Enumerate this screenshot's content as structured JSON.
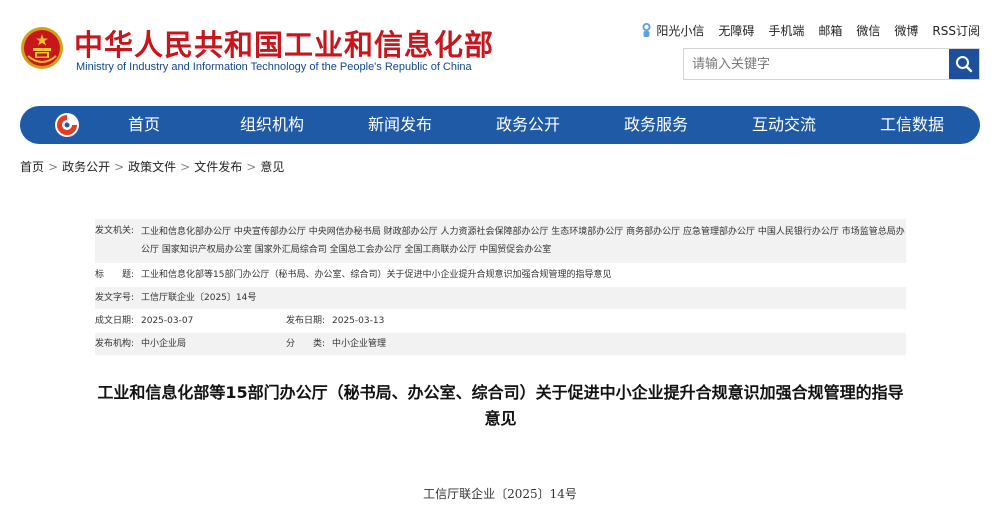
{
  "header": {
    "title_zh": "中华人民共和国工业和信息化部",
    "title_en": "Ministry of Industry and Information Technology of the People's Republic of China",
    "links": [
      "阳光小信",
      "无障碍",
      "手机端",
      "邮箱",
      "微信",
      "微博",
      "RSS订阅"
    ],
    "search_placeholder": "请输入关键字"
  },
  "nav": {
    "items": [
      "首页",
      "组织机构",
      "新闻发布",
      "政务公开",
      "政务服务",
      "互动交流",
      "工信数据"
    ]
  },
  "breadcrumb": [
    "首页",
    "政务公开",
    "政策文件",
    "文件发布",
    "意见"
  ],
  "meta": {
    "issuer_label": "发文机关:",
    "issuer_value": "工业和信息化部办公厅 中央宣传部办公厅 中央网信办秘书局 财政部办公厅 人力资源社会保障部办公厅 生态环境部办公厅 商务部办公厅 应急管理部办公厅 中国人民银行办公厅 市场监管总局办公厅 国家知识产权局办公室 国家外汇局综合司 全国总工会办公厅 全国工商联办公厅 中国贸促会办公室",
    "title_label": "标　　题:",
    "title_value": "工业和信息化部等15部门办公厅（秘书局、办公室、综合司）关于促进中小企业提升合规意识加强合规管理的指导意见",
    "docno_label": "发文字号:",
    "docno_value": "工信厅联企业〔2025〕14号",
    "created_label": "成文日期:",
    "created_value": "2025-03-07",
    "published_label": "发布日期:",
    "published_value": "2025-03-13",
    "org_label": "发布机构:",
    "org_value": "中小企业局",
    "category_label": "分　　类:",
    "category_value": "中小企业管理"
  },
  "article": {
    "title": "工业和信息化部等15部门办公厅（秘书局、办公室、综合司）关于促进中小企业提升合规意识加强合规管理的指导意见",
    "doc_number": "工信厅联企业〔2025〕14号"
  },
  "colors": {
    "brand_red": "#c8161d",
    "brand_blue": "#1f5aa7",
    "search_blue": "#1d4f9d"
  }
}
